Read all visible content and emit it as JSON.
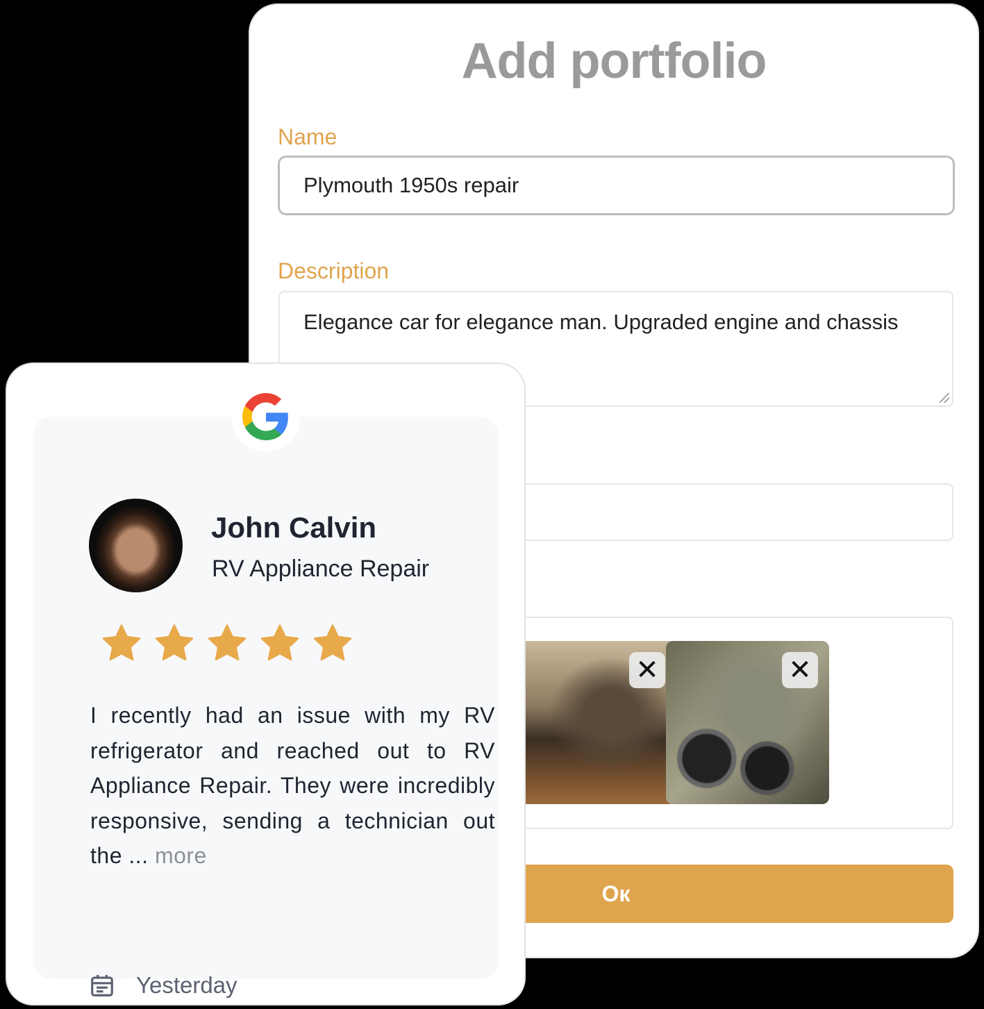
{
  "form": {
    "title": "Add portfolio",
    "name_label": "Name",
    "name_value": "Plymouth 1950s repair",
    "description_label": "Description",
    "description_value": "Elegance car for elegance man. Upgraded engine and chassis",
    "images": [
      {
        "icon": "close-icon",
        "remove_glyph": "✕"
      },
      {
        "icon": "close-icon",
        "remove_glyph": "✕"
      }
    ],
    "ok_label": "Oк",
    "accent_color": "#e0a44e"
  },
  "review": {
    "source_logo": "google-logo",
    "reviewer_name": "John Calvin",
    "business": "RV Appliance Repair",
    "rating": 5,
    "rating_max": 5,
    "star_color": "#e8a94a",
    "text": "I recently had an issue with my RV refrigerator and reached out to RV Appliance Repair. They were incredibly responsive, sending a technician out the ... ",
    "more_label": "more",
    "date": "Yesterday",
    "date_icon": "calendar-icon"
  }
}
